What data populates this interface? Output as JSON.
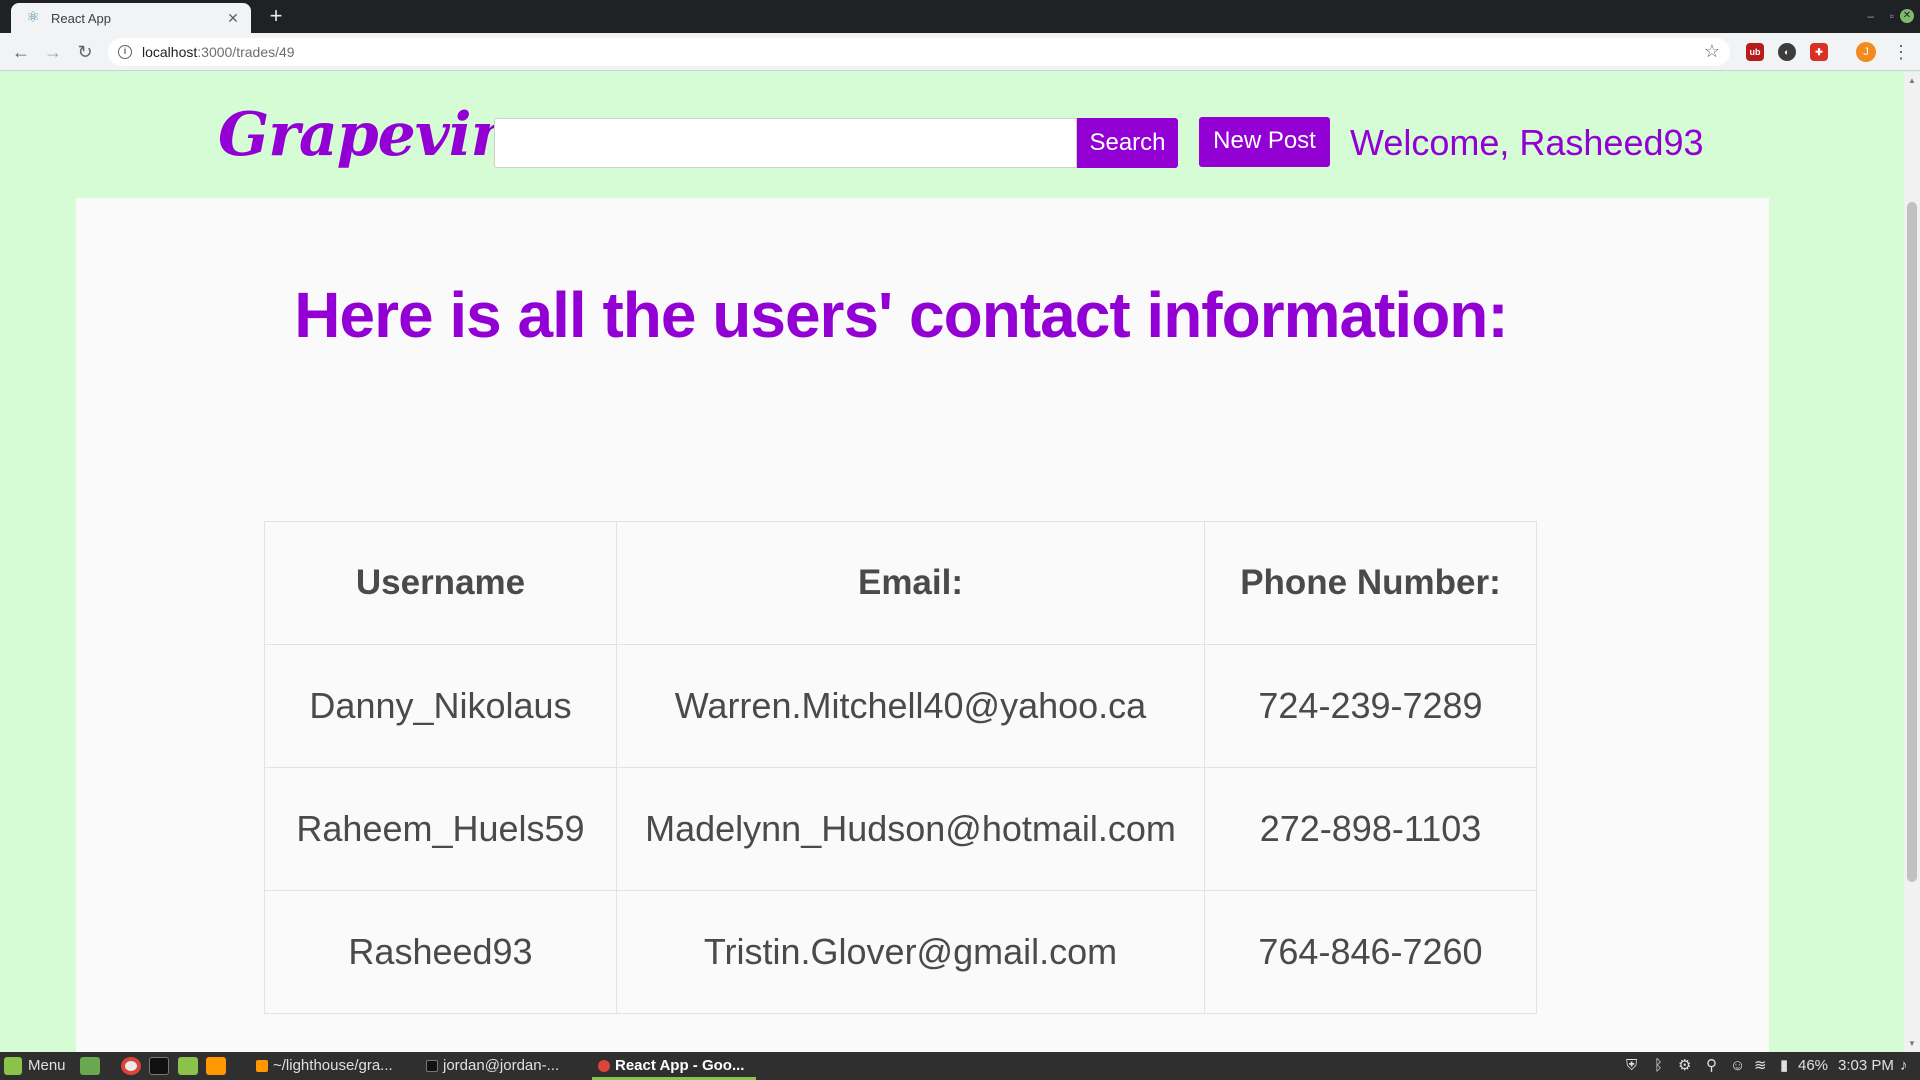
{
  "browser": {
    "tab_title": "React App",
    "url_host": "localhost",
    "url_path": ":3000/trades/49"
  },
  "header": {
    "brand": "Grapevine",
    "search_placeholder": "",
    "search_label": "Search",
    "new_post_label": "New Post",
    "welcome": "Welcome, Rasheed93"
  },
  "main": {
    "heading": "Here is all the users' contact information:",
    "table": {
      "headers": [
        "Username",
        "Email:",
        "Phone Number:"
      ],
      "rows": [
        [
          "Danny_Nikolaus",
          "Warren.Mitchell40@yahoo.ca",
          "724-239-7289"
        ],
        [
          "Raheem_Huels59",
          "Madelynn_Hudson@hotmail.com",
          "272-898-1103"
        ],
        [
          "Rasheed93",
          "Tristin.Glover@gmail.com",
          "764-846-7260"
        ]
      ]
    }
  },
  "taskbar": {
    "menu_label": "Menu",
    "windows": [
      "~/lighthouse/gra...",
      "jordan@jordan-...",
      "React App - Goo..."
    ],
    "battery": "46%",
    "clock": "3:03 PM"
  },
  "colors": {
    "accent": "#9200d4",
    "page_background": "#d6fcd6",
    "panel_background": "#fafafa",
    "table_text": "#4a4a4a"
  },
  "icons": {
    "tab_favicon": "react-icon",
    "back": "arrow-left-icon",
    "forward": "arrow-right-icon",
    "reload": "reload-icon",
    "bookmark": "star-icon"
  }
}
